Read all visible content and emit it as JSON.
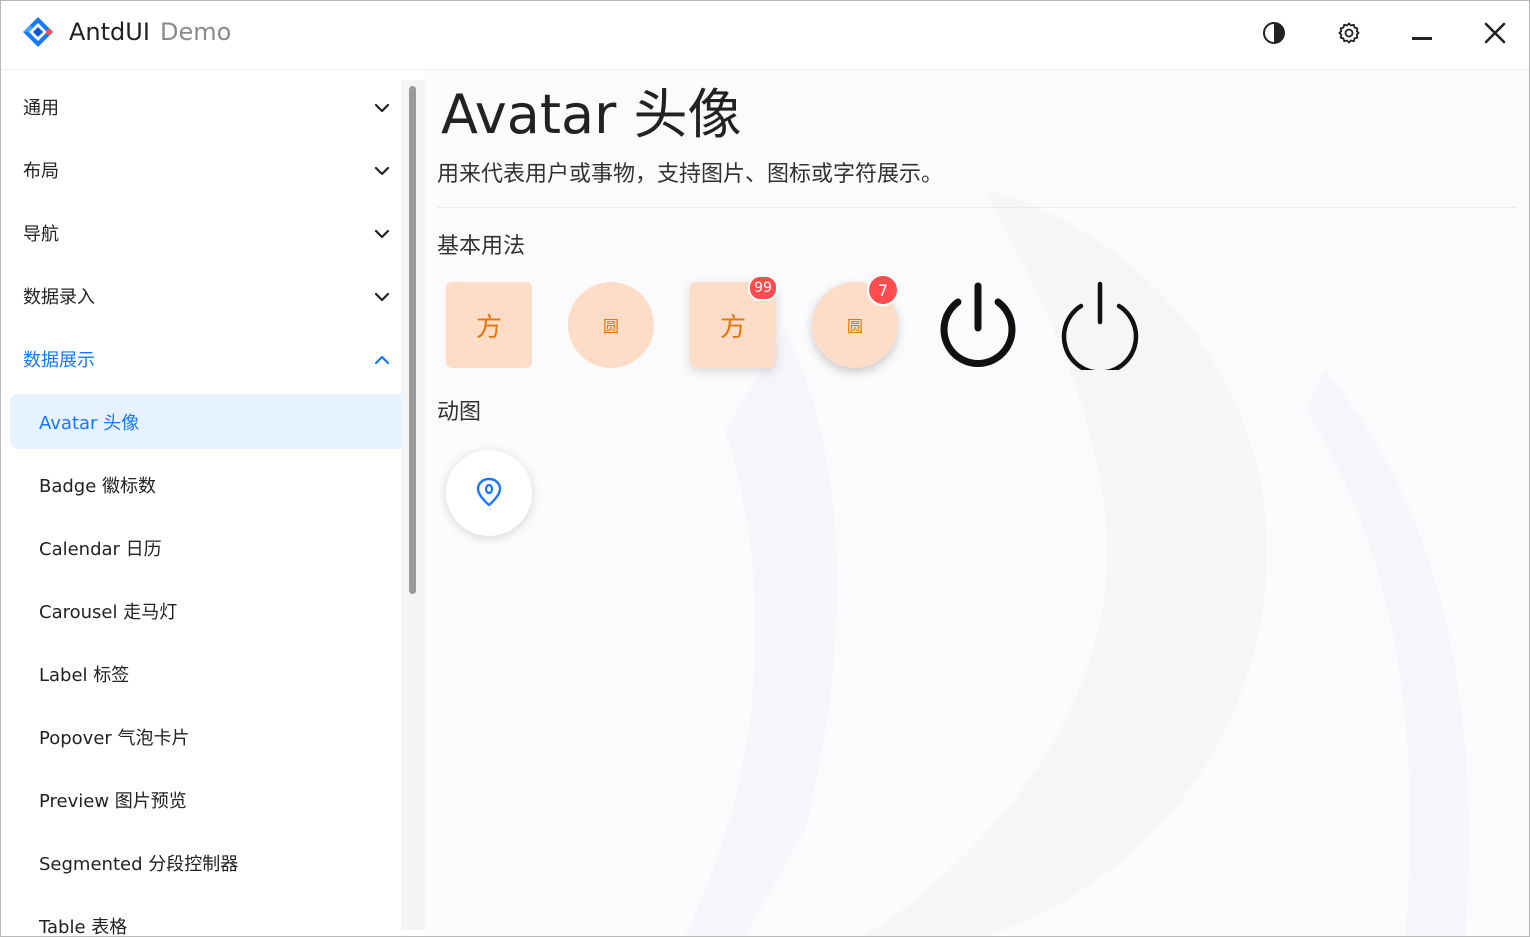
{
  "titlebar": {
    "title": "AntdUI",
    "subtitle": "Demo",
    "icons": [
      "theme-toggle-icon",
      "settings-gear-icon",
      "minimize-icon",
      "close-icon"
    ],
    "brand_color": "#1677ff"
  },
  "sidebar": {
    "groups": [
      {
        "label": "通用",
        "expanded": false
      },
      {
        "label": "布局",
        "expanded": false
      },
      {
        "label": "导航",
        "expanded": false
      },
      {
        "label": "数据录入",
        "expanded": false
      },
      {
        "label": "数据展示",
        "expanded": true
      }
    ],
    "items": [
      {
        "label": "Avatar 头像",
        "selected": true
      },
      {
        "label": "Badge 徽标数"
      },
      {
        "label": "Calendar 日历"
      },
      {
        "label": "Carousel 走马灯"
      },
      {
        "label": "Label 标签"
      },
      {
        "label": "Popover 气泡卡片"
      },
      {
        "label": "Preview 图片预览"
      },
      {
        "label": "Segmented 分段控制器"
      },
      {
        "label": "Table 表格"
      }
    ]
  },
  "main": {
    "title": "Avatar 头像",
    "description": "用来代表用户或事物，支持图片、图标或字符展示。",
    "section_basic": "基本用法",
    "section_gif": "动图",
    "avatars": [
      {
        "text": "方",
        "shape": "square",
        "badge": ""
      },
      {
        "text": "圆",
        "shape": "circle",
        "badge": ""
      },
      {
        "text": "方",
        "shape": "square",
        "badge": "99"
      },
      {
        "text": "圆",
        "shape": "circle",
        "badge": "7"
      }
    ],
    "avatar_color": "#e8750a",
    "avatar_bg": "#fddcc8",
    "badge_color": "#ff4d4f"
  }
}
